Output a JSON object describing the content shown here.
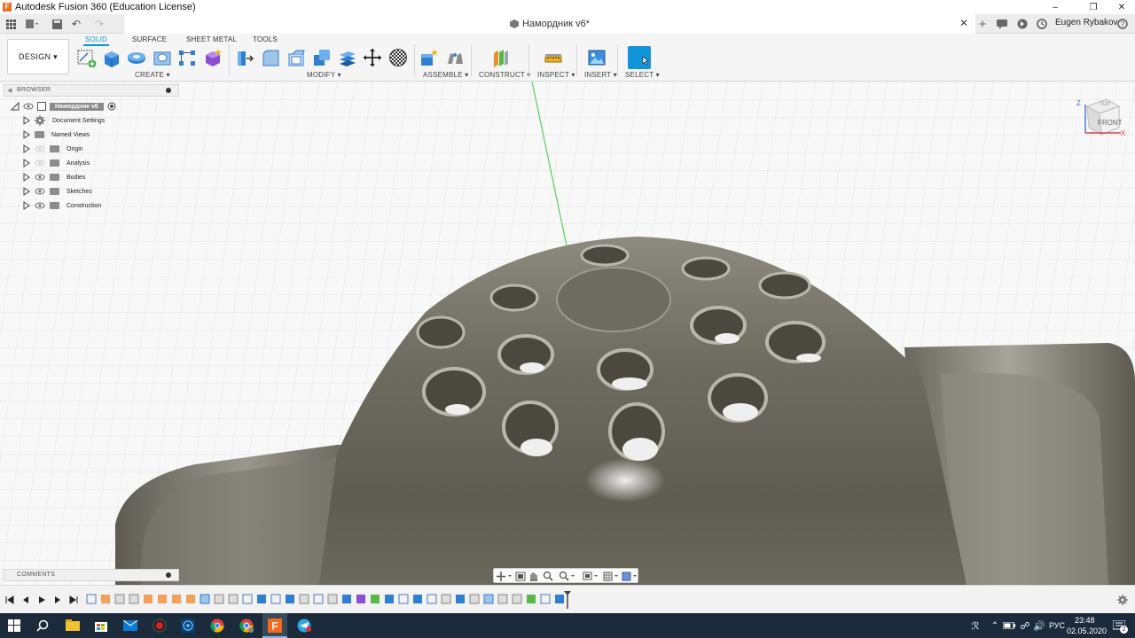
{
  "window": {
    "app_title": "Autodesk Fusion 360 (Education License)",
    "logo_letter": "F"
  },
  "tabbar": {
    "document_title": "Намордник v6*",
    "user_name": "Eugen Rybakov"
  },
  "ribbon": {
    "workspace": "DESIGN ▾",
    "tabs": [
      "SOLID",
      "SURFACE",
      "SHEET METAL",
      "TOOLS"
    ],
    "active_tab": "SOLID",
    "groups": {
      "create": "CREATE ▾",
      "modify": "MODIFY ▾",
      "assemble": "ASSEMBLE ▾",
      "construct": "CONSTRUCT ▾",
      "inspect": "INSPECT ▾",
      "insert": "INSERT ▾",
      "select": "SELECT ▾"
    },
    "accent_color": "#0696d7"
  },
  "browser": {
    "title": "BROWSER",
    "root": "Намордник v6",
    "items": [
      {
        "label": "Document Settings",
        "icon": "gear-icon"
      },
      {
        "label": "Named Views",
        "icon": "folder-icon"
      },
      {
        "label": "Origin",
        "icon": "folder-icon"
      },
      {
        "label": "Analysis",
        "icon": "folder-icon"
      },
      {
        "label": "Bodies",
        "icon": "folder-icon"
      },
      {
        "label": "Sketches",
        "icon": "folder-icon"
      },
      {
        "label": "Construction",
        "icon": "folder-icon"
      }
    ]
  },
  "viewcube": {
    "face_label": "FRONT",
    "top_label": "TOP",
    "axis_x": "X",
    "axis_z": "Z"
  },
  "comments": {
    "title": "COMMENTS"
  },
  "taskbar": {
    "tray_lang": "РУС",
    "time": "23:48",
    "date": "02.05.2020",
    "notification_count": "2"
  }
}
